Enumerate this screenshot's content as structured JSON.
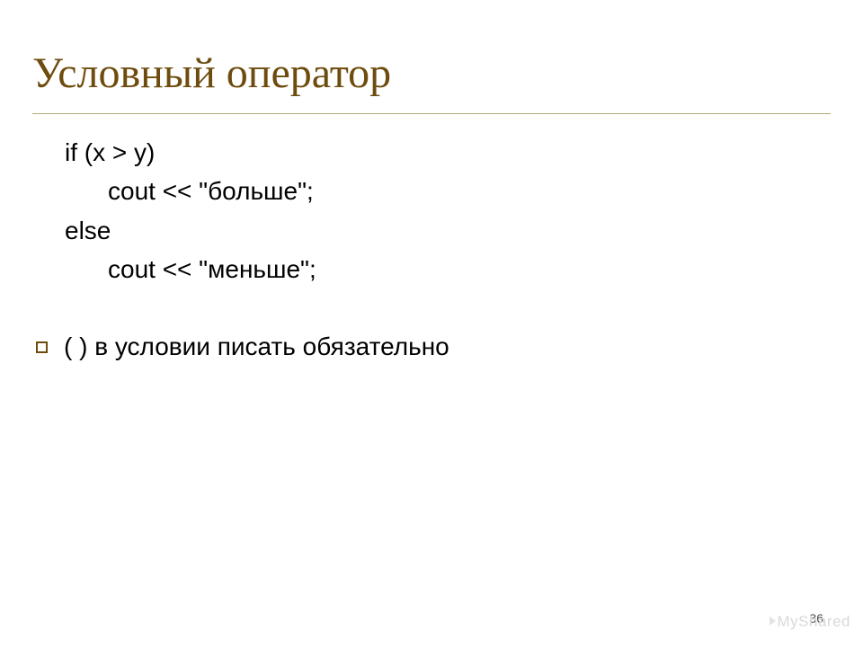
{
  "title": "Условный оператор",
  "code": {
    "line1": "if (x > y)",
    "line2": "cout << \"больше\";",
    "line3": "else",
    "line4": "cout << \"меньше\";"
  },
  "note": "(  )  в условии писать обязательно",
  "page_number": "36",
  "watermark": "MyShared"
}
